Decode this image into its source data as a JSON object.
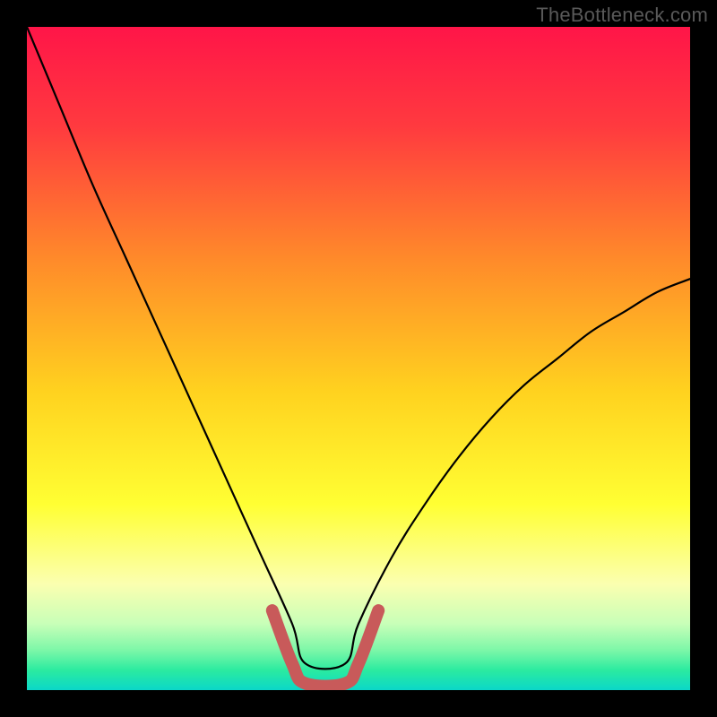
{
  "watermark": "TheBottleneck.com",
  "chart_data": {
    "type": "line",
    "title": "",
    "xlabel": "",
    "ylabel": "",
    "xlim": [
      0,
      100
    ],
    "ylim": [
      0,
      100
    ],
    "series": [
      {
        "name": "bottleneck-curve",
        "x": [
          0,
          5,
          10,
          15,
          20,
          25,
          30,
          35,
          40,
          42,
          48,
          50,
          55,
          60,
          65,
          70,
          75,
          80,
          85,
          90,
          95,
          100
        ],
        "values": [
          100,
          88,
          76,
          65,
          54,
          43,
          32,
          21,
          10,
          4,
          4,
          10,
          20,
          28,
          35,
          41,
          46,
          50,
          54,
          57,
          60,
          62
        ]
      },
      {
        "name": "optimal-highlight",
        "x": [
          37,
          40,
          42,
          48,
          50,
          53
        ],
        "values": [
          12,
          4,
          1,
          1,
          4,
          12
        ]
      }
    ],
    "gradient_bands": [
      {
        "pos": 0.0,
        "color": "#ff1548"
      },
      {
        "pos": 0.15,
        "color": "#ff3a3f"
      },
      {
        "pos": 0.35,
        "color": "#ff8a2a"
      },
      {
        "pos": 0.55,
        "color": "#ffd21f"
      },
      {
        "pos": 0.72,
        "color": "#ffff33"
      },
      {
        "pos": 0.84,
        "color": "#fbffb0"
      },
      {
        "pos": 0.9,
        "color": "#c8ffb8"
      },
      {
        "pos": 0.94,
        "color": "#7cf7a8"
      },
      {
        "pos": 0.97,
        "color": "#2beba0"
      },
      {
        "pos": 1.0,
        "color": "#0bd7c8"
      }
    ],
    "highlight_style": {
      "color": "#c85a5a",
      "width": 14
    },
    "curve_style": {
      "color": "#000000",
      "width": 2.2
    }
  }
}
